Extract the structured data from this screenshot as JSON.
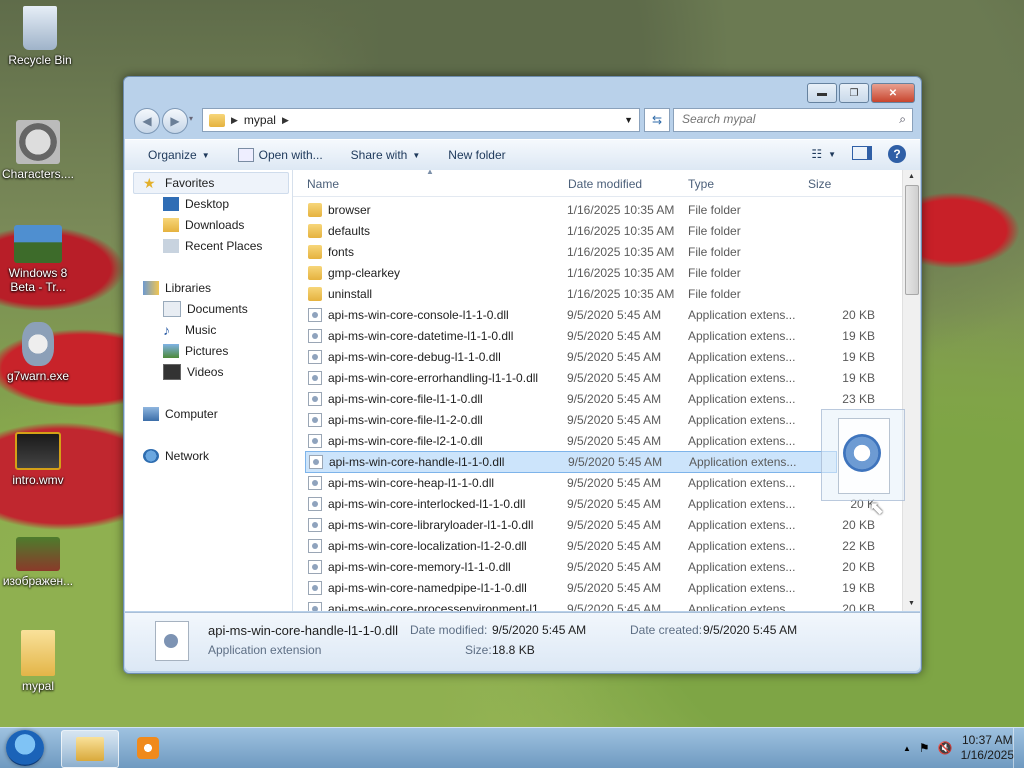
{
  "desktop": {
    "icons": [
      {
        "label": "Recycle Bin"
      },
      {
        "label": "Characters...."
      },
      {
        "label": "Windows 8 Beta - Tr..."
      },
      {
        "label": "g7warn.exe"
      },
      {
        "label": "intro.wmv"
      },
      {
        "label": "изображен..."
      },
      {
        "label": "mypal"
      }
    ]
  },
  "window": {
    "address": {
      "crumb": "mypal"
    },
    "search": {
      "placeholder": "Search mypal"
    },
    "toolbar": {
      "organize": "Organize",
      "open_with": "Open with...",
      "share_with": "Share with",
      "new_folder": "New folder"
    },
    "nav": {
      "favorites": "Favorites",
      "desktop": "Desktop",
      "downloads": "Downloads",
      "recent": "Recent Places",
      "libraries": "Libraries",
      "documents": "Documents",
      "music": "Music",
      "pictures": "Pictures",
      "videos": "Videos",
      "computer": "Computer",
      "network": "Network"
    },
    "columns": {
      "name": "Name",
      "date": "Date modified",
      "type": "Type",
      "size": "Size"
    },
    "files": [
      {
        "name": "browser",
        "date": "1/16/2025 10:35 AM",
        "type": "File folder",
        "size": ""
      },
      {
        "name": "defaults",
        "date": "1/16/2025 10:35 AM",
        "type": "File folder",
        "size": ""
      },
      {
        "name": "fonts",
        "date": "1/16/2025 10:35 AM",
        "type": "File folder",
        "size": ""
      },
      {
        "name": "gmp-clearkey",
        "date": "1/16/2025 10:35 AM",
        "type": "File folder",
        "size": ""
      },
      {
        "name": "uninstall",
        "date": "1/16/2025 10:35 AM",
        "type": "File folder",
        "size": ""
      },
      {
        "name": "api-ms-win-core-console-l1-1-0.dll",
        "date": "9/5/2020 5:45 AM",
        "type": "Application extens...",
        "size": "20 KB"
      },
      {
        "name": "api-ms-win-core-datetime-l1-1-0.dll",
        "date": "9/5/2020 5:45 AM",
        "type": "Application extens...",
        "size": "19 KB"
      },
      {
        "name": "api-ms-win-core-debug-l1-1-0.dll",
        "date": "9/5/2020 5:45 AM",
        "type": "Application extens...",
        "size": "19 KB"
      },
      {
        "name": "api-ms-win-core-errorhandling-l1-1-0.dll",
        "date": "9/5/2020 5:45 AM",
        "type": "Application extens...",
        "size": "19 KB"
      },
      {
        "name": "api-ms-win-core-file-l1-1-0.dll",
        "date": "9/5/2020 5:45 AM",
        "type": "Application extens...",
        "size": "23 KB"
      },
      {
        "name": "api-ms-win-core-file-l1-2-0.dll",
        "date": "9/5/2020 5:45 AM",
        "type": "Application extens...",
        "size": ""
      },
      {
        "name": "api-ms-win-core-file-l2-1-0.dll",
        "date": "9/5/2020 5:45 AM",
        "type": "Application extens...",
        "size": ""
      },
      {
        "name": "api-ms-win-core-handle-l1-1-0.dll",
        "date": "9/5/2020 5:45 AM",
        "type": "Application extens...",
        "size": ""
      },
      {
        "name": "api-ms-win-core-heap-l1-1-0.dll",
        "date": "9/5/2020 5:45 AM",
        "type": "Application extens...",
        "size": ""
      },
      {
        "name": "api-ms-win-core-interlocked-l1-1-0.dll",
        "date": "9/5/2020 5:45 AM",
        "type": "Application extens...",
        "size": "20 K"
      },
      {
        "name": "api-ms-win-core-libraryloader-l1-1-0.dll",
        "date": "9/5/2020 5:45 AM",
        "type": "Application extens...",
        "size": "20 KB"
      },
      {
        "name": "api-ms-win-core-localization-l1-2-0.dll",
        "date": "9/5/2020 5:45 AM",
        "type": "Application extens...",
        "size": "22 KB"
      },
      {
        "name": "api-ms-win-core-memory-l1-1-0.dll",
        "date": "9/5/2020 5:45 AM",
        "type": "Application extens...",
        "size": "20 KB"
      },
      {
        "name": "api-ms-win-core-namedpipe-l1-1-0.dll",
        "date": "9/5/2020 5:45 AM",
        "type": "Application extens...",
        "size": "19 KB"
      },
      {
        "name": "api-ms-win-core-processenvironment-l1...",
        "date": "9/5/2020 5:45 AM",
        "type": "Application extens...",
        "size": "20 KB"
      }
    ],
    "selected_index": 12,
    "details": {
      "name": "api-ms-win-core-handle-l1-1-0.dll",
      "type": "Application extension",
      "date_modified_label": "Date modified:",
      "date_modified": "9/5/2020 5:45 AM",
      "date_created_label": "Date created:",
      "date_created": "9/5/2020 5:45 AM",
      "size_label": "Size:",
      "size": "18.8 KB"
    }
  },
  "taskbar": {
    "time": "10:37 AM",
    "date": "1/16/2025"
  },
  "colors": {
    "selection": "#cce4fb",
    "window_frame": "#b9d1ea",
    "taskbar": "#7fa7cc"
  }
}
